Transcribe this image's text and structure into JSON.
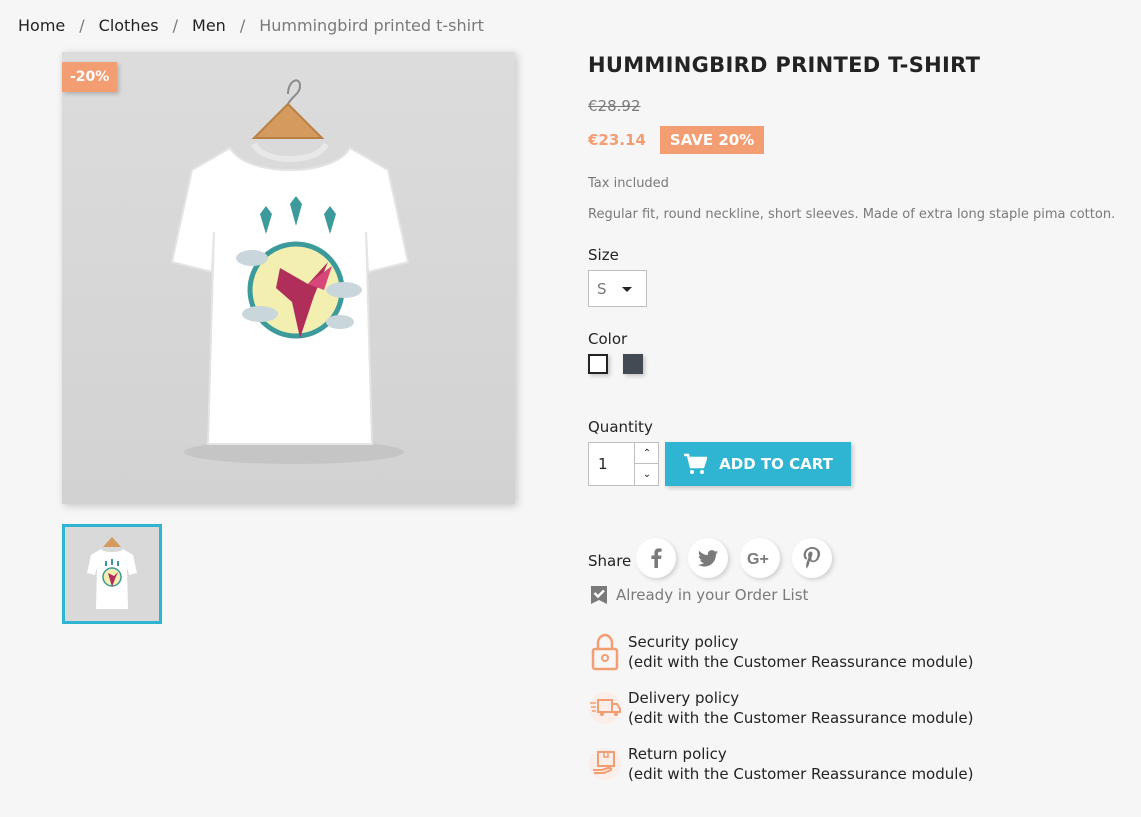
{
  "breadcrumb": {
    "items": [
      "Home",
      "Clothes",
      "Men"
    ],
    "separator": "/",
    "current": "Hummingbird printed t-shirt"
  },
  "product": {
    "discount_flag": "-20%",
    "title": "Hummingbird printed t-shirt",
    "old_price": "€28.92",
    "price": "€23.14",
    "save_label": "Save 20%",
    "tax_text": "Tax included",
    "description": "Regular fit, round neckline, short sleeves. Made of extra long staple pima cotton."
  },
  "options": {
    "size_label": "Size",
    "size_value": "S",
    "color_label": "Color",
    "colors": [
      {
        "name": "White",
        "hex": "#ffffff"
      },
      {
        "name": "Black",
        "hex": "#434a54"
      }
    ]
  },
  "cart": {
    "quantity_label": "Quantity",
    "quantity_value": "1",
    "add_label": "Add to cart"
  },
  "share": {
    "label": "Share",
    "networks": [
      "facebook-icon",
      "twitter-icon",
      "googleplus-icon",
      "pinterest-icon"
    ]
  },
  "order_list": "Already in your Order List",
  "reassurance": [
    {
      "title": "Security policy",
      "subtitle": "(edit with the Customer Reassurance module)",
      "icon": "lock-icon"
    },
    {
      "title": "Delivery policy",
      "subtitle": "(edit with the Customer Reassurance module)",
      "icon": "truck-icon"
    },
    {
      "title": "Return policy",
      "subtitle": "(edit with the Customer Reassurance module)",
      "icon": "return-box-icon"
    }
  ],
  "colors": {
    "accent": "#2fb5d2",
    "discount": "#f39d72",
    "text": "#232323",
    "muted": "#7a7a7a",
    "background": "#f6f6f6"
  }
}
